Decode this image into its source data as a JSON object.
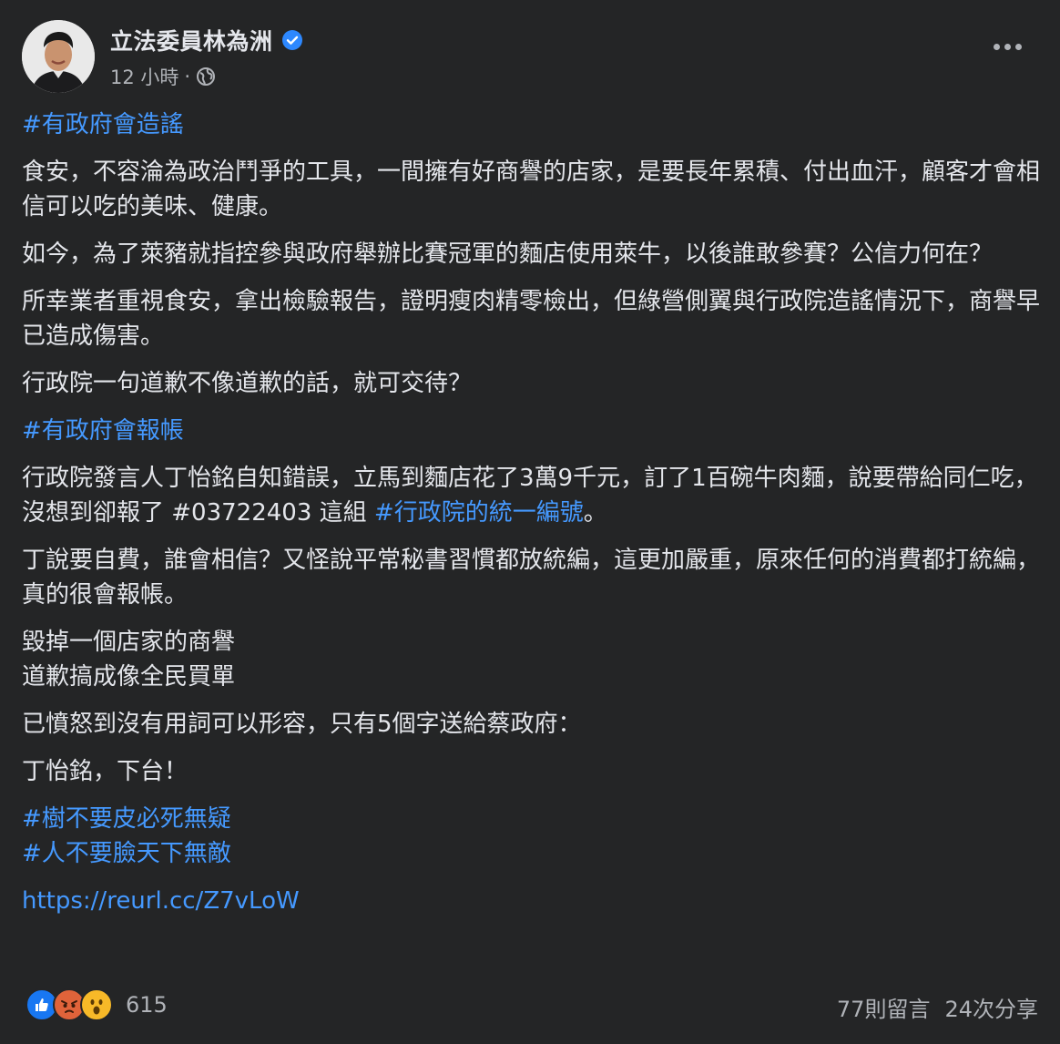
{
  "post": {
    "author": "立法委員林為洲",
    "time": "12 小時",
    "dot": "·"
  },
  "content": {
    "tag1": "#有政府會造謠",
    "p1": "食安，不容淪為政治鬥爭的工具，一間擁有好商譽的店家，是要長年累積、付出血汗，顧客才會相信可以吃的美味、健康。",
    "p2": "如今，為了萊豬就指控參與政府舉辦比賽冠軍的麵店使用萊牛，以後誰敢參賽？公信力何在？",
    "p3": "所幸業者重視食安，拿出檢驗報告，證明瘦肉精零檢出，但綠營側翼與行政院造謠情況下，商譽早已造成傷害。",
    "p4": "行政院一句道歉不像道歉的話，就可交待？",
    "tag2": "#有政府會報帳",
    "p5_before": "行政院發言人丁怡銘自知錯誤，立馬到麵店花了3萬9千元，訂了1百碗牛肉麵，說要帶給同仁吃，沒想到卻報了 #03722403 這組 ",
    "p5_tag": "#行政院的統一編號",
    "p5_after": "。",
    "p6": "丁說要自費，誰會相信？又怪說平常秘書習慣都放統編，這更加嚴重，原來任何的消費都打統編，真的很會報帳。",
    "p7_line1": "毀掉一個店家的商譽",
    "p7_line2": "道歉搞成像全民買單",
    "p8": "已憤怒到沒有用詞可以形容，只有5個字送給蔡政府：",
    "p9": "丁怡銘，下台！",
    "tag3": "#樹不要皮必死無疑",
    "tag4": "#人不要臉天下無敵",
    "url": "https://reurl.cc/Z7vLoW"
  },
  "footer": {
    "reaction_count": "615",
    "comments": "77則留言",
    "shares": "24次分享"
  },
  "colors": {
    "background": "#242526",
    "text": "#e4e6eb",
    "secondary": "#b0b3b8",
    "link": "#4599ff",
    "verified": "#2d88ff"
  }
}
